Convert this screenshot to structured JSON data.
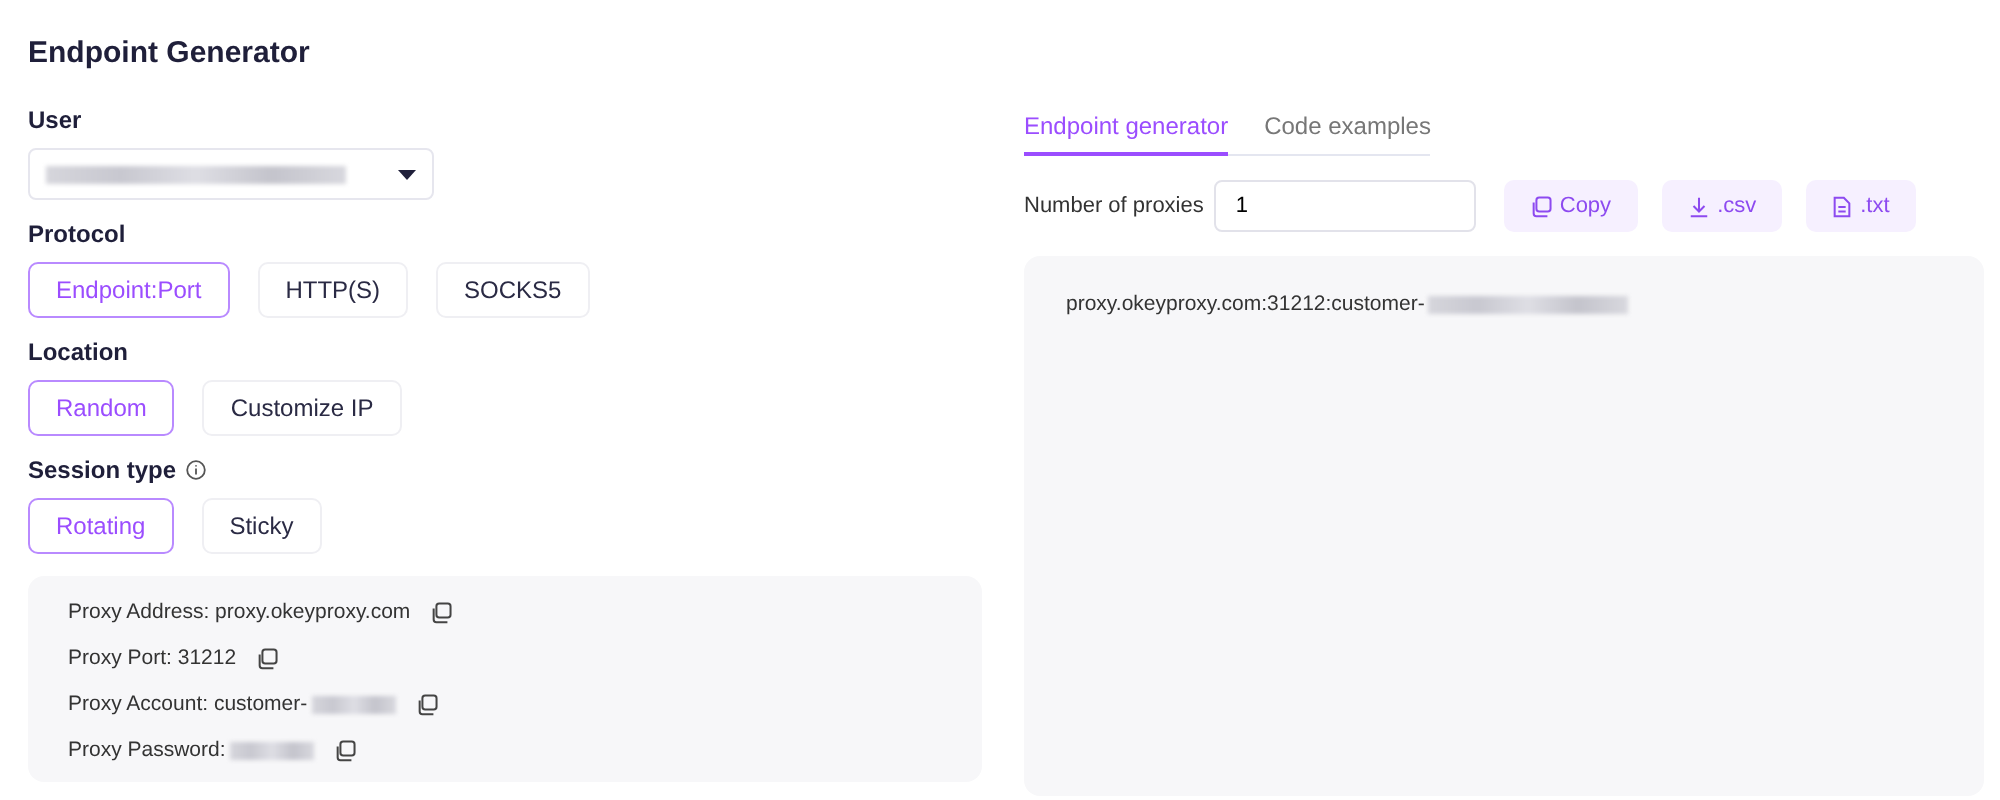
{
  "title": "Endpoint Generator",
  "user": {
    "label": "User",
    "masked": true
  },
  "protocol": {
    "label": "Protocol",
    "options": [
      {
        "label": "Endpoint:Port",
        "selected": true
      },
      {
        "label": "HTTP(S)",
        "selected": false
      },
      {
        "label": "SOCKS5",
        "selected": false
      }
    ]
  },
  "location": {
    "label": "Location",
    "options": [
      {
        "label": "Random",
        "selected": true
      },
      {
        "label": "Customize IP",
        "selected": false
      }
    ]
  },
  "session_type": {
    "label": "Session type",
    "options": [
      {
        "label": "Rotating",
        "selected": true
      },
      {
        "label": "Sticky",
        "selected": false
      }
    ]
  },
  "details": [
    {
      "text": "Proxy Address: proxy.okeyproxy.com",
      "masked": false
    },
    {
      "text": "Proxy Port: 31212",
      "masked": false
    },
    {
      "text": "Proxy Account: customer-",
      "masked": true
    },
    {
      "text": "Proxy Password:",
      "masked": true
    }
  ],
  "tabs": [
    {
      "label": "Endpoint generator",
      "selected": true
    },
    {
      "label": "Code examples",
      "selected": false
    }
  ],
  "number_of_proxies": {
    "label": "Number of proxies",
    "value": "1"
  },
  "actions": [
    {
      "kind": "copy",
      "label": "Copy"
    },
    {
      "kind": "download",
      "label": ".csv"
    },
    {
      "kind": "file",
      "label": ".txt"
    }
  ],
  "output": {
    "text": "proxy.okeyproxy.com:31212:customer-",
    "masked": true
  }
}
